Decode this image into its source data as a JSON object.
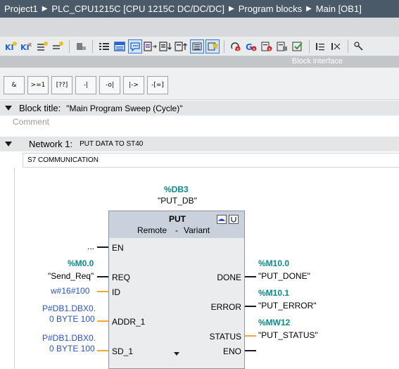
{
  "breadcrumb": [
    "Project1",
    "PLC_CPU1215C [CPU 1215C DC/DC/DC]",
    "Program blocks",
    "Main [OB1]"
  ],
  "toolbar": {
    "icons": [
      "insert-network-icon",
      "delete-network-icon",
      "insert-row-icon",
      "add-row-icon",
      "go-online-icon",
      "show-all-icon",
      "show-absolute-icon",
      "show-comments-icon",
      "show-favorites-icon",
      "download-icon",
      "upload-icon",
      "list-icon",
      "favorite-star-icon",
      "reset-icon",
      "go-to-next-error-icon",
      "go-to-prev-error-icon",
      "monitor-icon",
      "check-icon",
      "open-all-icon",
      "close-all-icon",
      "tree-icon"
    ],
    "block_interface_label": "Block interface"
  },
  "palette": [
    "&",
    ">=1",
    "[??]",
    "-|",
    "-o|",
    "|->",
    "-[=]"
  ],
  "block_title": {
    "label": "Block title:",
    "value": "\"Main Program Sweep (Cycle)\""
  },
  "comment_placeholder": "Comment",
  "network": {
    "label": "Network 1:",
    "title": "PUT DATA TO ST40",
    "comment": "S7 COMMUNICATION"
  },
  "block": {
    "instance_address": "%DB3",
    "instance_name": "\"PUT_DB\"",
    "name": "PUT",
    "header_left": "Remote",
    "header_mid": "-",
    "header_right": "Variant",
    "inputs": [
      {
        "pin": "EN",
        "address": "",
        "symbol": "..."
      },
      {
        "pin": "REQ",
        "address": "%M0.0",
        "symbol": "\"Send_Req\""
      },
      {
        "pin": "ID",
        "address": "",
        "symbol": "w#16#100"
      },
      {
        "pin": "ADDR_1",
        "address": "",
        "symbol": "P#DB1.DBX0.",
        "symbol2": "0 BYTE 100"
      },
      {
        "pin": "SD_1",
        "address": "",
        "symbol": "P#DB1.DBX0.",
        "symbol2": "0 BYTE 100"
      }
    ],
    "outputs": [
      {
        "pin": "DONE",
        "address": "%M10.0",
        "symbol": "\"PUT_DONE\""
      },
      {
        "pin": "ERROR",
        "address": "%M10.1",
        "symbol": "\"PUT_ERROR\""
      },
      {
        "pin": "STATUS",
        "address": "%MW12",
        "symbol": "\"PUT_STATUS\""
      },
      {
        "pin": "ENO",
        "address": "",
        "symbol": ""
      }
    ]
  },
  "colors": {
    "teal": "#0b8a8c",
    "blue": "#2a52c4",
    "wire_bool": "#1a1a1a",
    "wire_data": "#f2a73b",
    "breadcrumb_bg": "#4a5a68"
  }
}
